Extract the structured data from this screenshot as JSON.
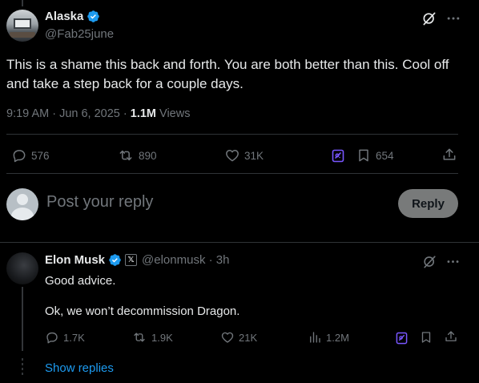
{
  "main_tweet": {
    "name": "Alaska",
    "handle": "@Fab25june",
    "text": "This is a shame this back and forth. You are both better than this. Cool off and take a step back for a couple days.",
    "timestamp": "9:19 AM · Jun 6, 2025 · ",
    "views_count": "1.1M",
    "views_label": "Views",
    "actions": {
      "replies": "576",
      "reposts": "890",
      "likes": "31K",
      "bookmarks": "654"
    }
  },
  "reply_box": {
    "placeholder": "Post your reply",
    "button_label": "Reply"
  },
  "reply": {
    "name": "Elon Musk",
    "handle_time": "@elonmusk · 3h",
    "affiliate_badge": "𝕏",
    "line1": "Good advice.",
    "line2": "Ok, we won’t decommission Dragon.",
    "actions": {
      "replies": "1.7K",
      "reposts": "1.9K",
      "likes": "21K",
      "views": "1.2M"
    },
    "show_replies": "Show replies"
  },
  "colors": {
    "background": "#000000",
    "text": "#e7e9ea",
    "muted": "#71767b",
    "verified": "#1d9bf0",
    "link": "#1d9bf0",
    "grok": "#7856ff",
    "divider": "#2f3336"
  },
  "icons": [
    "grok-icon",
    "more-icon",
    "reply-icon",
    "repost-icon",
    "like-icon",
    "bookmark-icon",
    "share-icon",
    "views-icon",
    "verified-icon"
  ]
}
